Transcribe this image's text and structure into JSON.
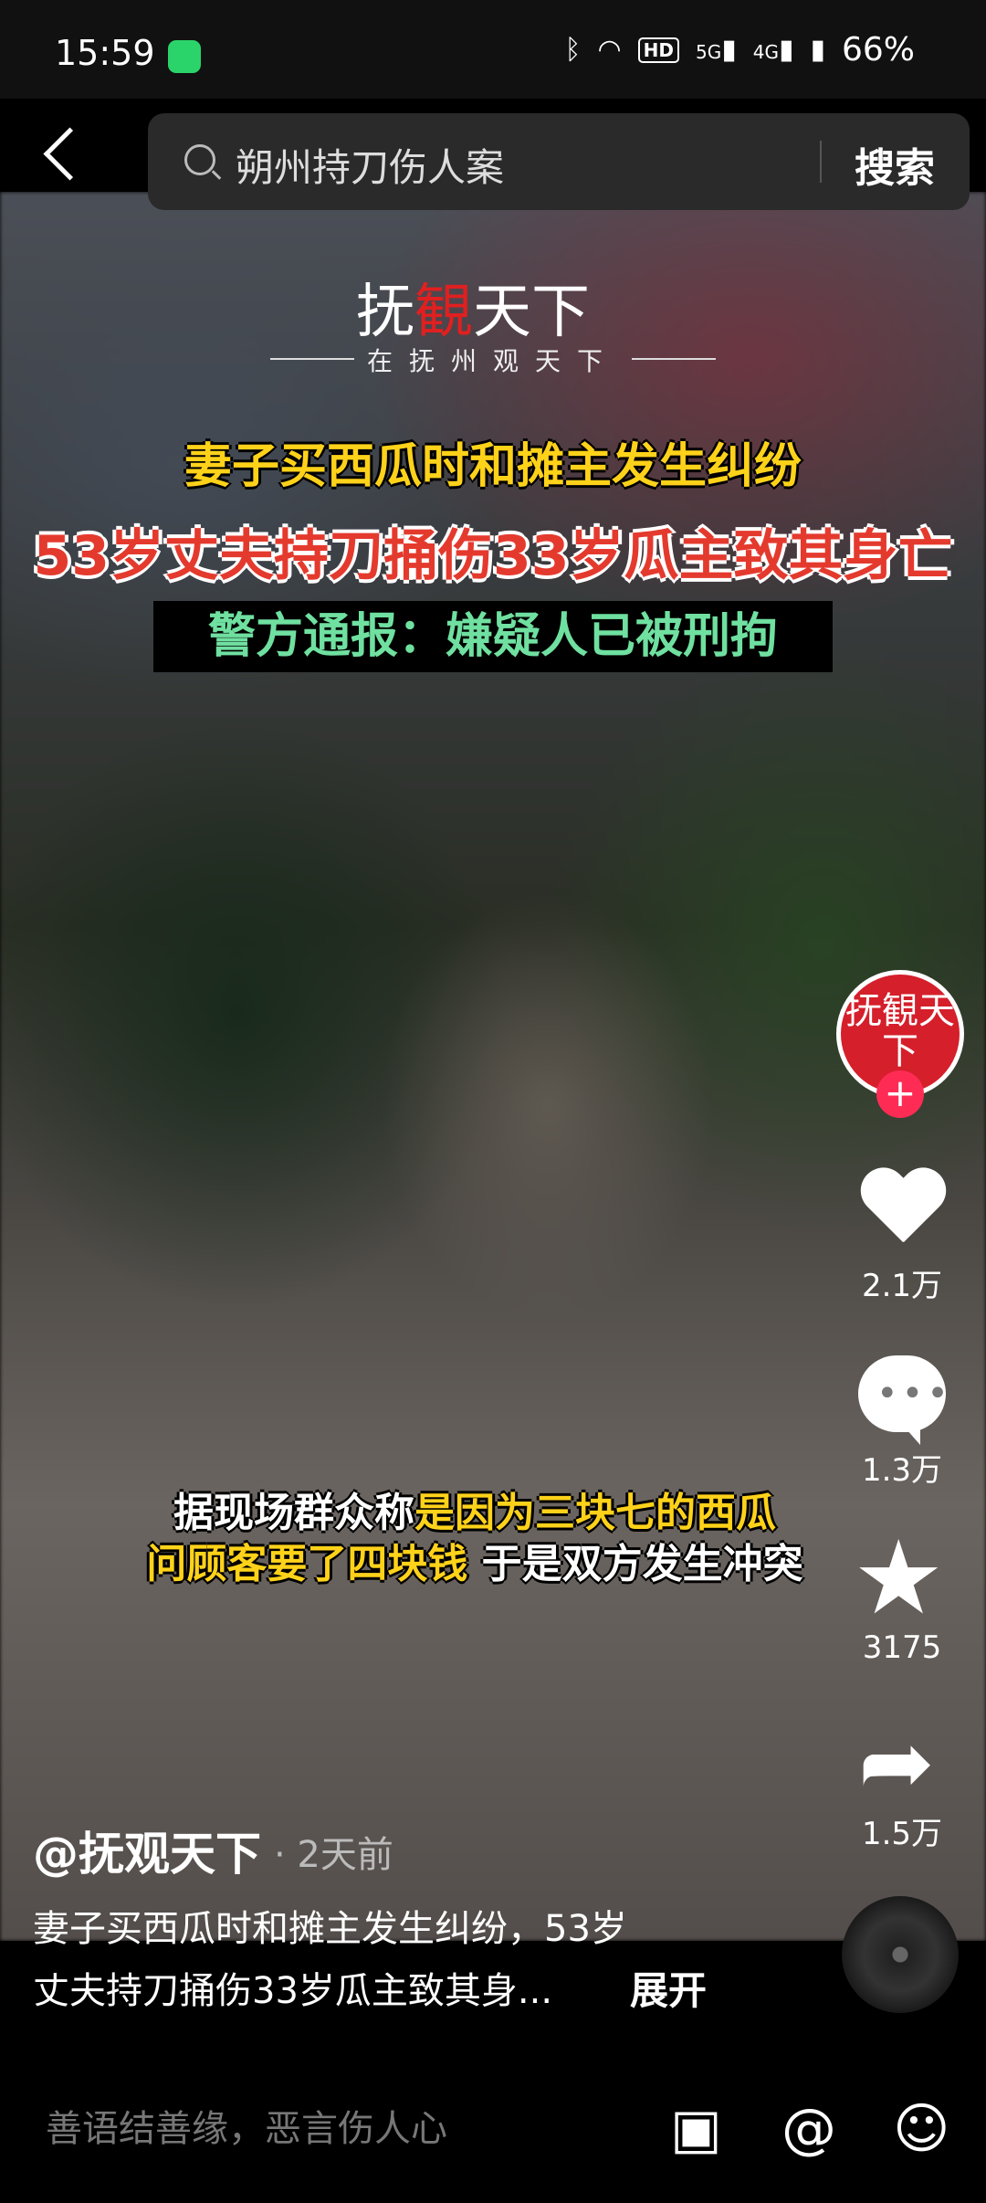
{
  "status": {
    "time": "15:59",
    "battery": "66%",
    "net1": "5G",
    "net2": "4G",
    "hd": "HD"
  },
  "search": {
    "query": "朔州持刀伤人案",
    "button": "搜索"
  },
  "video": {
    "logo_a": "抚",
    "logo_b": "観",
    "logo_c": "天下",
    "slogan": "在抚州观天下",
    "headline1": "妻子买西瓜时和摊主发生纠纷",
    "headline2": "53岁丈夫持刀捅伤33岁瓜主致其身亡",
    "headline3": "警方通报：嫌疑人已被刑拘",
    "subtitle1_a": "据现场群众称",
    "subtitle1_b": "是因为三块七的西瓜",
    "subtitle2_a": "问顾客要了四块钱",
    "subtitle2_b": " 于是双方发生冲突"
  },
  "side": {
    "avatar_text": "抚観天下",
    "follow": "+",
    "likes": "2.1万",
    "comments": "1.3万",
    "favorites": "3175",
    "shares": "1.5万"
  },
  "post": {
    "author": "@抚观天下",
    "time_ago": "· 2天前",
    "desc_line1": "妻子买西瓜时和摊主发生纠纷，53岁",
    "desc_line2": "丈夫持刀捅伤33岁瓜主致其身...",
    "expand": "展开"
  },
  "comment_bar": {
    "placeholder": "善语结善缘，恶言伤人心"
  }
}
